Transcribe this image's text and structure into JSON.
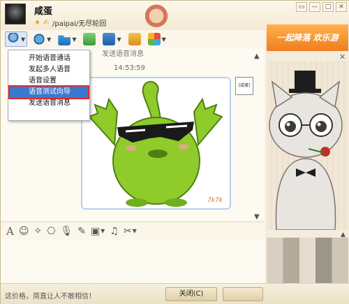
{
  "header": {
    "contact_name": "咸蛋",
    "status_text": "/paipai/无尽轮回"
  },
  "window_controls": {
    "minimize": "▭",
    "maximize": "□",
    "close": "✕"
  },
  "toolbar": {
    "tools": [
      {
        "icon": "microphone-icon"
      },
      {
        "icon": "video-icon"
      },
      {
        "icon": "folder-icon"
      },
      {
        "icon": "chat-bubble-icon"
      },
      {
        "icon": "screen-icon"
      },
      {
        "icon": "share-screen-icon"
      },
      {
        "icon": "apps-icon"
      }
    ]
  },
  "voice_menu": {
    "items": [
      {
        "label": "开始语音通话",
        "selected": false
      },
      {
        "label": "发起多人语音",
        "selected": false
      },
      {
        "label": "语音设置",
        "selected": false
      },
      {
        "label": "语音测试向导",
        "selected": true
      },
      {
        "label": "发送语音消息",
        "selected": false
      }
    ]
  },
  "chat": {
    "partial_text": "发送语音消息",
    "timestamp": "14:53:59",
    "sender_badge": "[咸蛋]",
    "sticker_watermark": "7k7k"
  },
  "input_toolbar": {
    "tools": [
      "font-icon",
      "emoji-icon",
      "magic-icon",
      "screenshot-icon",
      "voice-message-icon",
      "edit-icon",
      "image-icon",
      "music-icon",
      "scissors-icon"
    ]
  },
  "footer": {
    "signature": "这价格，简直让人不敢相信！",
    "close_button": "关闭(C)"
  },
  "ad_panel": {
    "banner_text": "一起降落 欢乐游"
  },
  "colors": {
    "menu_highlight": "#3b79cf",
    "highlight_border": "#e0262c",
    "sticker_green": "#8ecb2b"
  }
}
